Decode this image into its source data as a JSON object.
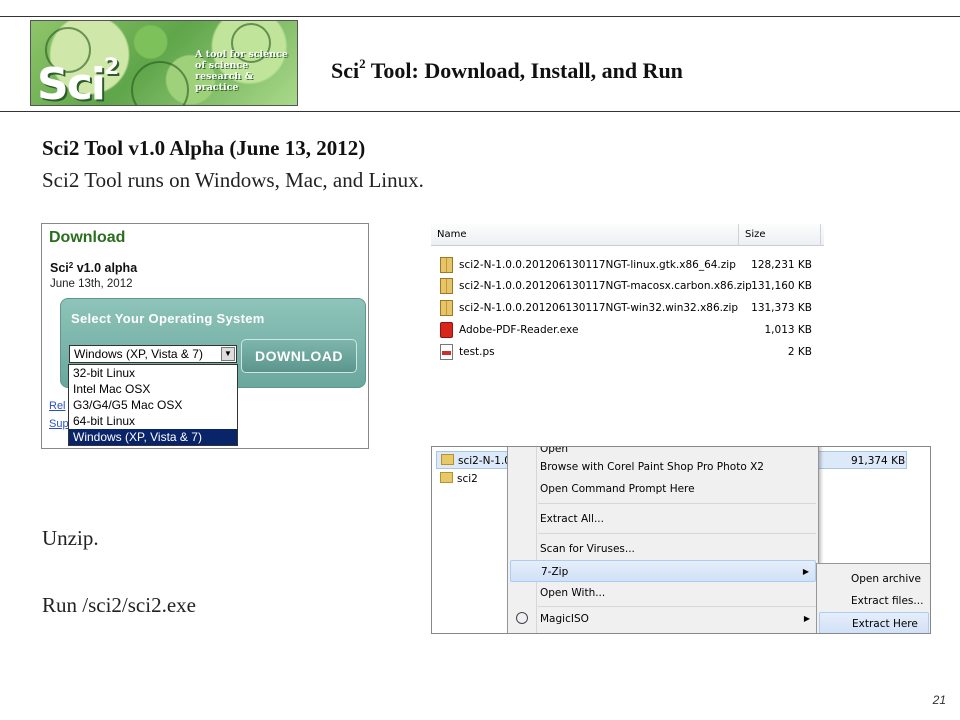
{
  "header": {
    "logo_word": "Sci",
    "logo_sup": "2",
    "logo_tagline": "A tool for science of science research & practice",
    "title_prefix": "Sci",
    "title_sup": "2",
    "title_rest": " Tool: Download, Install, and Run"
  },
  "body": {
    "heading": "Sci2 Tool v1.0 Alpha (June 13, 2012)",
    "subheading": "Sci2 Tool runs on Windows, Mac, and Linux.",
    "step_unzip": "Unzip.",
    "step_run": "Run /sci2/sci2.exe",
    "page_number": "21"
  },
  "download_panel": {
    "heading": "Download",
    "version_prefix": "Sci",
    "version_sup": "2",
    "version_rest": " v1.0 alpha",
    "date": "June 13th, 2012",
    "select_label": "Select Your Operating System",
    "selected_value": "Windows (XP, Vista & 7)",
    "button_label": "DOWNLOAD",
    "link1": "Rel",
    "link2": "Sup",
    "options": [
      "32-bit Linux",
      "Intel Mac OSX",
      "G3/G4/G5 Mac OSX",
      "64-bit Linux",
      "Windows (XP, Vista & 7)"
    ],
    "selected_index": 4
  },
  "file_list": {
    "columns": {
      "name": "Name",
      "size": "Size"
    },
    "rows": [
      {
        "name": "sci2-N-1.0.0.201206130117NGT-linux.gtk.x86_64.zip",
        "size": "128,231 KB",
        "icon": "zip-icon"
      },
      {
        "name": "sci2-N-1.0.0.201206130117NGT-macosx.carbon.x86.zip",
        "size": "131,160 KB",
        "icon": "zip-icon"
      },
      {
        "name": "sci2-N-1.0.0.201206130117NGT-win32.win32.x86.zip",
        "size": "131,373 KB",
        "icon": "zip-icon"
      },
      {
        "name": "Adobe-PDF-Reader.exe",
        "size": "1,013 KB",
        "icon": "pdf-icon"
      },
      {
        "name": "test.ps",
        "size": "2 KB",
        "icon": "ps-file-icon"
      }
    ]
  },
  "context_window": {
    "file_row_1": "sci2-N-1.0",
    "file_row_2": "sci2",
    "size_value": "91,374 KB",
    "menu": {
      "items": [
        {
          "label": "Open"
        },
        {
          "label": "Browse with Corel Paint Shop Pro Photo X2"
        },
        {
          "label": "Open Command Prompt Here"
        },
        {
          "label": "Extract All..."
        },
        {
          "label": "Scan for Viruses..."
        },
        {
          "label": "7-Zip"
        },
        {
          "label": "Open With..."
        },
        {
          "label": "MagicISO"
        }
      ]
    },
    "submenu": {
      "items": [
        {
          "label": "Open archive"
        },
        {
          "label": "Extract files..."
        },
        {
          "label": "Extract Here"
        }
      ]
    }
  }
}
